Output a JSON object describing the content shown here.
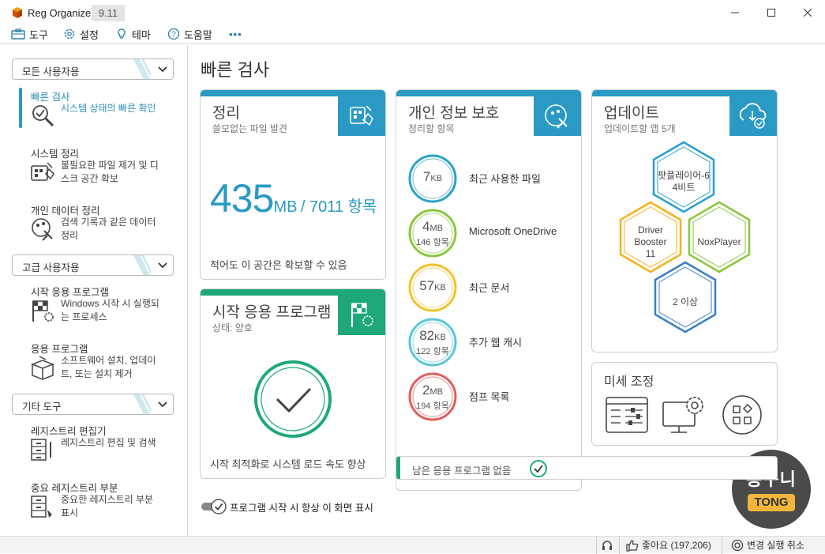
{
  "app": {
    "title": "Reg Organizer",
    "version": "9.11"
  },
  "menu": {
    "tools": "도구",
    "settings": "설정",
    "theme": "테마",
    "help": "도움말",
    "more": "•••"
  },
  "sidebar": {
    "groups": [
      "모든 사용자용",
      "고급 사용자용",
      "기타 도구"
    ],
    "items": [
      {
        "title": "빠른 검사",
        "desc": "시스템 상태의 빠른 확인"
      },
      {
        "title": "시스템 정리",
        "desc": "불필요한 파일 제거 및 디스크 공간 확보"
      },
      {
        "title": "개인 데이터 정리",
        "desc": "검색 기록과 같은 데이터 정리"
      },
      {
        "title": "시작 응용 프로그램",
        "desc": "Windows 시작 시 실행되는 프로세스"
      },
      {
        "title": "응용 프로그램",
        "desc": "소프트웨어 설치, 업데이트, 또는 설치 제거"
      },
      {
        "title": "레지스트리 편집기",
        "desc": "레지스트리 편집 및 검색"
      },
      {
        "title": "중요 레지스트리 부분",
        "desc": "중요한 레지스트리 부분 표시"
      }
    ]
  },
  "main": {
    "title": "빠른 검사",
    "cleanup": {
      "title": "정리",
      "subtitle": "쓸모없는 파일 발견",
      "amount": "435",
      "unit": "MB",
      "items": "/ 7011 항목",
      "footer": "적어도 이 공간은 확보할 수 있음"
    },
    "startup": {
      "title": "시작 응용 프로그램",
      "subtitle": "상태: 양호",
      "footer": "시작 최적화로 시스템 로드 속도 향상"
    },
    "privacy": {
      "title": "개인 정보 보호",
      "subtitle": "정리할 항목",
      "rows": [
        {
          "value": "7",
          "unit": "KB",
          "count": "",
          "label": "최근 사용한 파일",
          "color": "#2aa3c8"
        },
        {
          "value": "4",
          "unit": "MB",
          "count": "146 항목",
          "label": "Microsoft OneDrive",
          "color": "#8cc63f"
        },
        {
          "value": "57",
          "unit": "KB",
          "count": "",
          "label": "최근 문서",
          "color": "#f5c02a"
        },
        {
          "value": "82",
          "unit": "KB",
          "count": "122 항목",
          "label": "추가 웹 캐시",
          "color": "#5cc6d6"
        },
        {
          "value": "2",
          "unit": "MB",
          "count": "194 항목",
          "label": "점프 목록",
          "color": "#e35d5d"
        }
      ]
    },
    "updates": {
      "title": "업데이트",
      "subtitle": "업데이트할 앱 5개",
      "apps": [
        {
          "line1": "팟플레이어-6",
          "line2": "4비트",
          "line3": "",
          "color": "#2a9dd6"
        },
        {
          "line1": "Driver",
          "line2": "Booster",
          "line3": "11",
          "color": "#f5b21e"
        },
        {
          "line1": "NoxPlayer",
          "line2": "",
          "line3": "",
          "color": "#8cc63f"
        },
        {
          "line1": "2 이상",
          "line2": "",
          "line3": "",
          "color": "#3a7fc1"
        }
      ]
    },
    "finetune": {
      "title": "미세 조정"
    },
    "remaining": "남은 응용 프로그램 없음",
    "toggle_label": "프로그램 시작 시 항상 이 화면 표시"
  },
  "statusbar": {
    "like": "좋아요 (197,206)",
    "undo": "변경 실행 취소"
  },
  "watermark": {
    "line1": "통구니",
    "line2": "TONG"
  },
  "colors": {
    "accent": "#2a9ac4",
    "green": "#1ea879",
    "updates_green": "#8cc63f"
  }
}
